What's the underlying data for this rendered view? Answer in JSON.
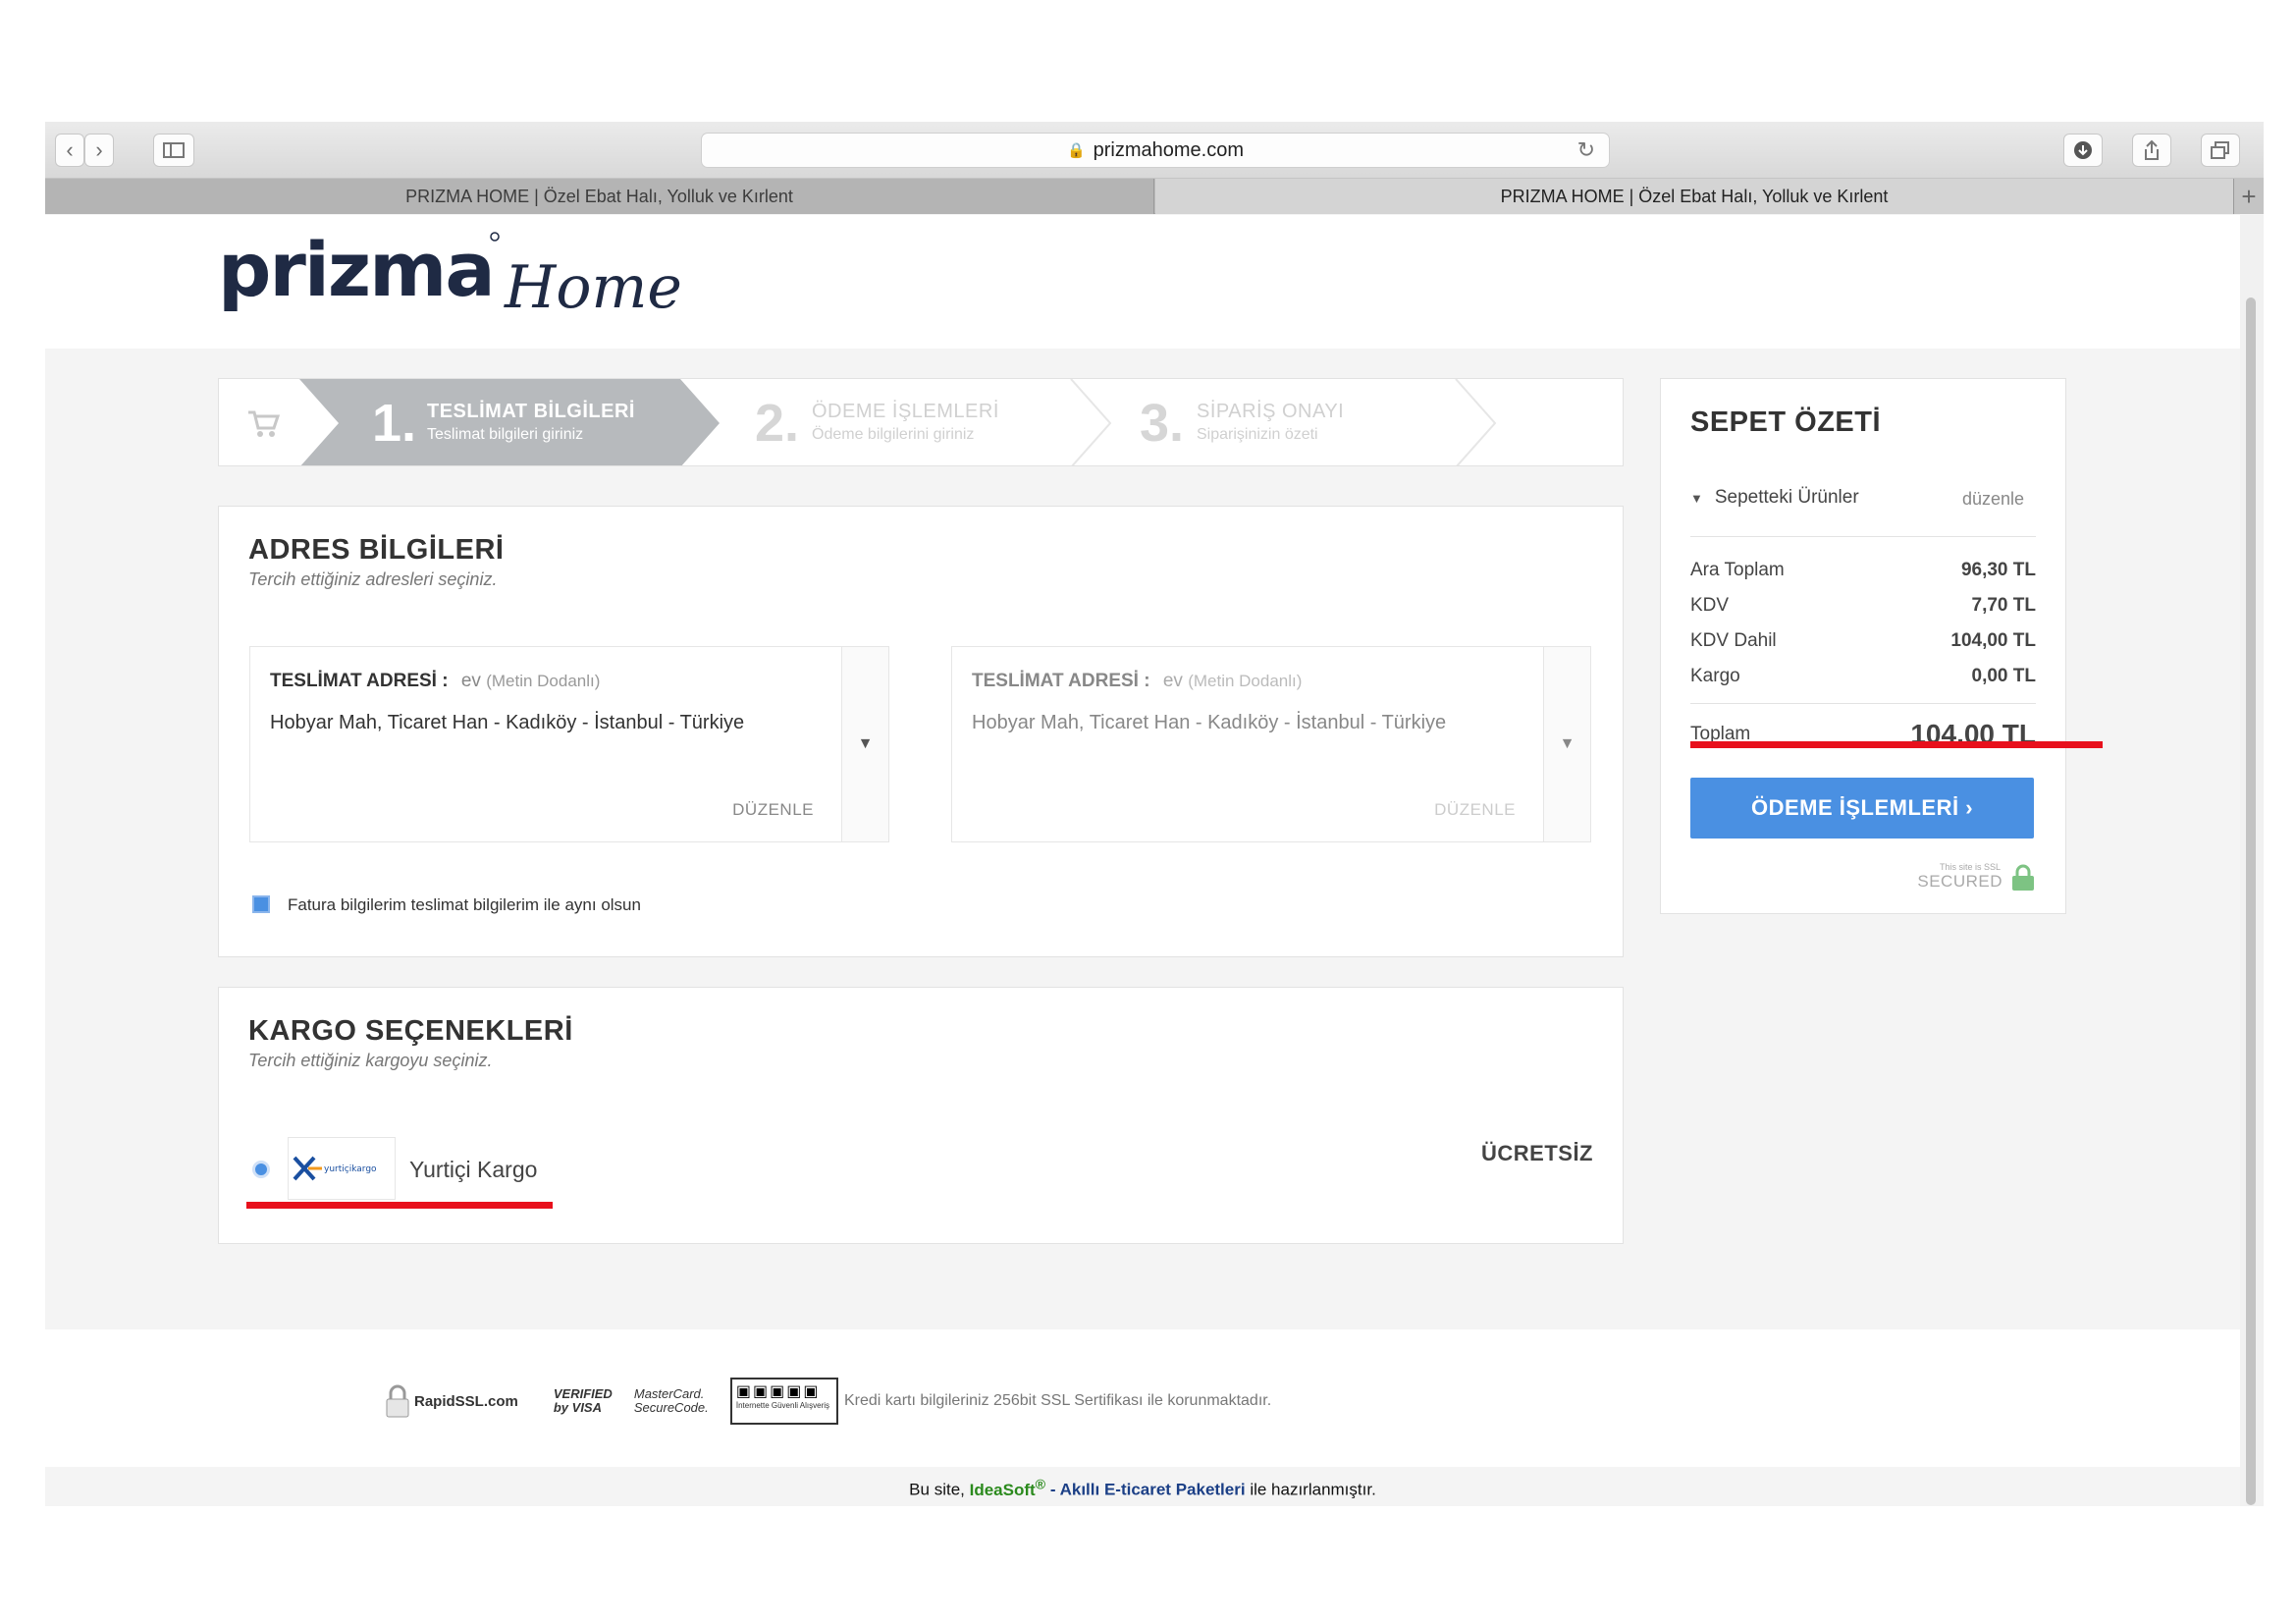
{
  "browser": {
    "url": "prizmahome.com",
    "tabs": [
      {
        "title": "PRIZMA HOME | Özel Ebat Halı, Yolluk ve Kırlent"
      },
      {
        "title": "PRIZMA HOME | Özel Ebat Halı, Yolluk ve Kırlent"
      }
    ],
    "new_tab": "+"
  },
  "logo": {
    "brand": "prizma",
    "script": "Home"
  },
  "steps": [
    {
      "number": "1.",
      "title": "TESLİMAT BİLGİLERİ",
      "subtitle": "Teslimat bilgileri giriniz"
    },
    {
      "number": "2.",
      "title": "ÖDEME İŞLEMLERİ",
      "subtitle": "Ödeme bilgilerini giriniz"
    },
    {
      "number": "3.",
      "title": "SİPARİŞ ONAYI",
      "subtitle": "Siparişinizin özeti"
    }
  ],
  "address": {
    "title": "ADRES BİLGİLERİ",
    "subtitle": "Tercih ettiğiniz adresleri seçiniz.",
    "boxes": [
      {
        "label": "TESLİMAT ADRESİ :",
        "name": "ev",
        "person": "(Metin Dodanlı)",
        "line": "Hobyar Mah, Ticaret Han - Kadıköy - İstanbul - Türkiye",
        "edit": "DÜZENLE"
      },
      {
        "label": "TESLİMAT ADRESİ :",
        "name": "ev",
        "person": "(Metin Dodanlı)",
        "line": "Hobyar Mah, Ticaret Han - Kadıköy - İstanbul - Türkiye",
        "edit": "DÜZENLE"
      }
    ],
    "same_billing": "Fatura bilgilerim teslimat bilgilerim ile aynı olsun"
  },
  "cargo": {
    "title": "KARGO SEÇENEKLERİ",
    "subtitle": "Tercih ettiğiniz kargoyu seçiniz.",
    "option_name": "Yurtiçi Kargo",
    "logo_text": "yurtiçikargo",
    "price": "ÜCRETSİZ"
  },
  "summary": {
    "title": "SEPET ÖZETİ",
    "items_label": "Sepetteki Ürünler",
    "edit": "düzenle",
    "rows": [
      {
        "label": "Ara Toplam",
        "value": "96,30 TL"
      },
      {
        "label": "KDV",
        "value": "7,70 TL"
      },
      {
        "label": "KDV Dahil",
        "value": "104,00 TL"
      },
      {
        "label": "Kargo",
        "value": "0,00 TL"
      }
    ],
    "total_label": "Toplam",
    "total_value": "104,00 TL",
    "pay_button": "ÖDEME İŞLEMLERİ  ›",
    "ssl_small": "This site is SSL",
    "ssl_big": "SECURED"
  },
  "footer": {
    "badges": {
      "rapidssl": "RapidSSL.com",
      "visa": "VERIFIED by VISA",
      "mastercard": "MasterCard. SecureCode.",
      "guvenli": "İnternette Güvenli Alışveriş"
    },
    "ssl_note": "Kredi kartı bilgileriniz 256bit SSL Sertifikası ile korunmaktadır.",
    "credit_prefix": "Bu site,",
    "credit_brand": "IdeaSoft",
    "credit_mark": "®",
    "credit_link": "- Akıllı E-ticaret Paketleri",
    "credit_suffix": "ile hazırlanmıştır."
  },
  "colors": {
    "accent": "#4a90e2",
    "highlight": "#e8101c",
    "step_active": "#b7babd",
    "logo": "#1f2a44"
  }
}
